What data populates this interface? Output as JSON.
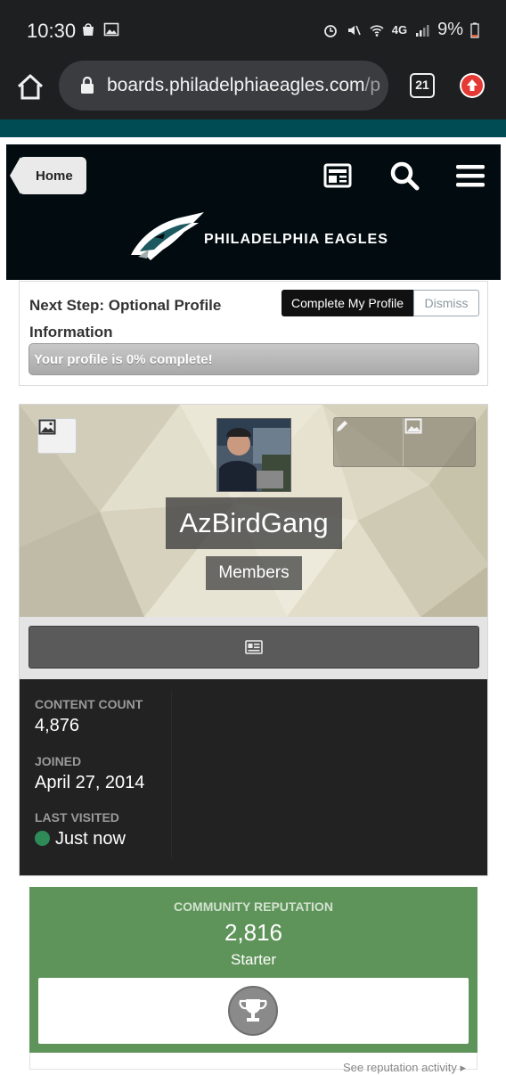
{
  "status_bar": {
    "time": "10:30",
    "network": "4G",
    "battery": "9%"
  },
  "browser": {
    "url_host": "boards.philadelphiaeagles.com",
    "url_path": "/p",
    "tab_count": "21"
  },
  "header": {
    "breadcrumb": "Home",
    "logo_text": "PHILADELPHIA EAGLES"
  },
  "next_step": {
    "title": "Next Step: Optional Profile Information",
    "complete_label": "Complete My Profile",
    "dismiss_label": "Dismiss",
    "progress_text": "Your profile is 0% complete!",
    "progress_percent": 0
  },
  "profile": {
    "username": "AzBirdGang",
    "group": "Members",
    "stats": [
      {
        "label": "CONTENT COUNT",
        "value": "4,876"
      },
      {
        "label": "JOINED",
        "value": "April 27, 2014"
      },
      {
        "label": "LAST VISITED",
        "value": "Just now"
      }
    ]
  },
  "reputation": {
    "title": "COMMUNITY REPUTATION",
    "value": "2,816",
    "rank": "Starter",
    "link": "See reputation activity"
  },
  "colors": {
    "online": "#2e8b57",
    "reputation_green": "#5e9459",
    "eagles_teal": "#004c54"
  }
}
